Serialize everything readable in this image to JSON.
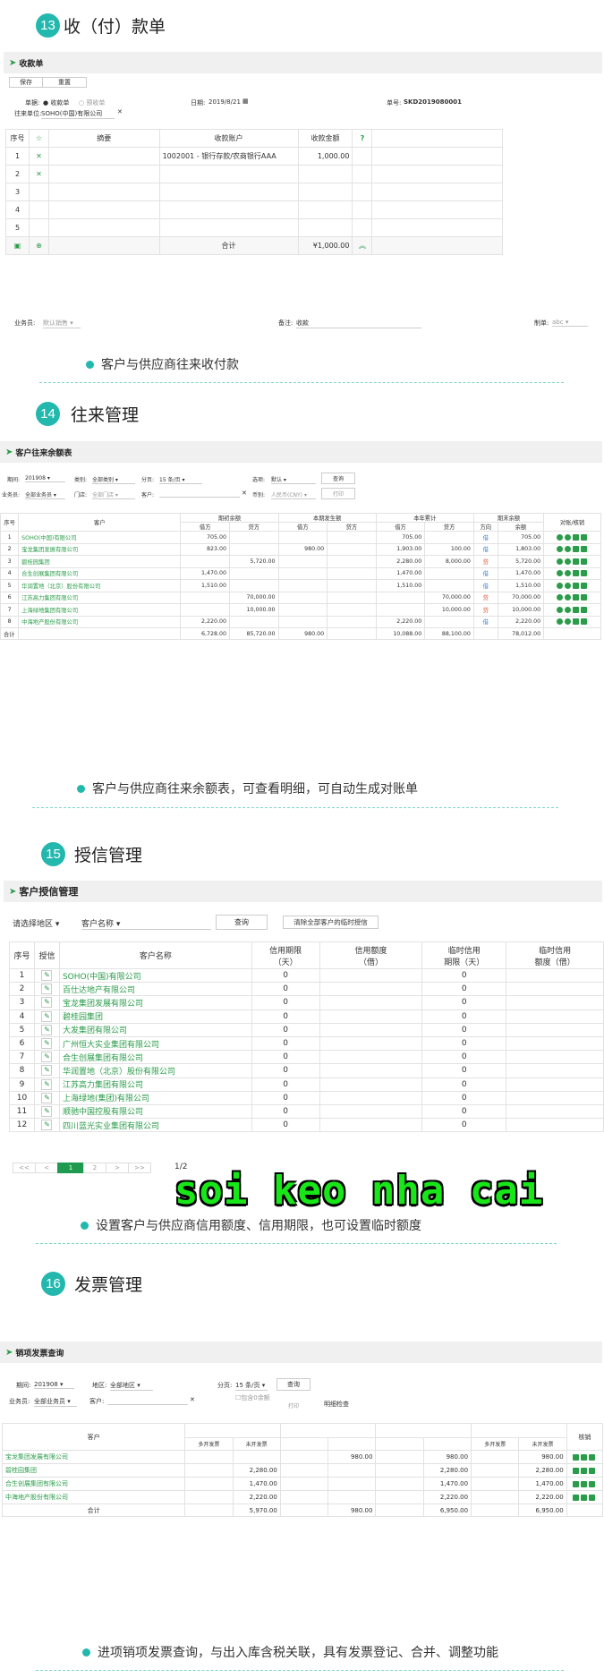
{
  "s13": {
    "num": "13",
    "title": "收（付）款单",
    "bar": "收款单",
    "btn_save": "保存",
    "btn_reset": "重置",
    "doc_type_label": "单据:",
    "opt_receipt": "收款单",
    "opt_prereceipt": "预收单",
    "date_label": "日期:",
    "date": "2019/8/21",
    "no_label": "单号:",
    "no": "SKD2019080001",
    "partner_label": "往来单位:",
    "partner": "SOHO(中国)有限公司",
    "cols": [
      "序号",
      "",
      "摘要",
      "收款账户",
      "收款金额",
      "?"
    ],
    "rows": [
      [
        "1",
        "1002001 - 银行存款/农商银行AAA",
        "1,000.00"
      ],
      [
        "2",
        "",
        ""
      ],
      [
        "3",
        "",
        ""
      ],
      [
        "4",
        "",
        ""
      ],
      [
        "5",
        "",
        ""
      ]
    ],
    "sum_label": "合计",
    "sum": "¥1,000.00",
    "foot_sales_label": "业务员:",
    "foot_sales": "默认销售",
    "foot_note_label": "备注:",
    "foot_note": "收款",
    "foot_maker_label": "制单:",
    "foot_maker": "abc",
    "bullet": "客户与供应商往来收付款"
  },
  "s14": {
    "num": "14",
    "title": "往来管理",
    "bar": "客户往来余额表",
    "f_period_l": "期间:",
    "f_period": "201908",
    "f_cat_l": "类别:",
    "f_cat": "全部类别",
    "f_page_l": "分页:",
    "f_page": "15 条/页",
    "f_opt_l": "选项:",
    "f_opt": "默认",
    "btn_query": "查询",
    "f_staff_l": "业务员:",
    "f_staff": "全部业务员",
    "f_store_l": "门店:",
    "f_store": "全部门店",
    "f_cust_l": "客户:",
    "f_cur_l": "币别:",
    "f_cur": "人民币(CNY)",
    "btn_print": "打印",
    "h1": [
      "序号",
      "客户",
      "期初余额",
      "本期发生额",
      "本年累计",
      "期末余额",
      "对账/核销"
    ],
    "h2": [
      "借方",
      "贷方",
      "借方",
      "贷方",
      "借方",
      "贷方",
      "方向",
      "余额"
    ],
    "rows": [
      [
        "1",
        "SOHO(中国)有限公司",
        "705.00",
        "",
        "",
        "",
        "705.00",
        "",
        "借",
        "705.00"
      ],
      [
        "2",
        "宝龙集团发展有限公司",
        "823.00",
        "",
        "980.00",
        "",
        "1,903.00",
        "100.00",
        "借",
        "1,803.00"
      ],
      [
        "3",
        "碧桂园集团",
        "",
        "5,720.00",
        "",
        "",
        "2,280.00",
        "8,000.00",
        "贷",
        "5,720.00"
      ],
      [
        "4",
        "合生创展集团有限公司",
        "1,470.00",
        "",
        "",
        "",
        "1,470.00",
        "",
        "借",
        "1,470.00"
      ],
      [
        "5",
        "华润置地（北京）股份有限公司",
        "1,510.00",
        "",
        "",
        "",
        "1,510.00",
        "",
        "借",
        "1,510.00"
      ],
      [
        "6",
        "江苏高力集团有限公司",
        "",
        "70,000.00",
        "",
        "",
        "",
        "70,000.00",
        "贷",
        "70,000.00"
      ],
      [
        "7",
        "上海绿地集团有限公司",
        "",
        "10,000.00",
        "",
        "",
        "",
        "10,000.00",
        "贷",
        "10,000.00"
      ],
      [
        "8",
        "中海地产股份有限公司",
        "2,220.00",
        "",
        "",
        "",
        "2,220.00",
        "",
        "借",
        "2,220.00"
      ]
    ],
    "total_label": "合计",
    "total": [
      "6,728.00",
      "85,720.00",
      "980.00",
      "",
      "10,088.00",
      "88,100.00",
      "",
      "78,012.00"
    ],
    "bullet": "客户与供应商往来余额表，可查看明细，可自动生成对账单"
  },
  "s15": {
    "num": "15",
    "title": "授信管理",
    "bar": "客户授信管理",
    "f_region": "请选择地区",
    "f_name": "客户名称",
    "btn_query": "查询",
    "btn_clear": "清除全部客户的临时授信",
    "cols": [
      "序号",
      "授信",
      "客户名称",
      "信用期限\n（天）",
      "信用额度\n（借）",
      "临时信用\n期限（天）",
      "临时信用\n额度（借）"
    ],
    "rows": [
      [
        "1",
        "SOHO(中国)有限公司",
        "0",
        "0"
      ],
      [
        "2",
        "百仕达地产有限公司",
        "0",
        "0"
      ],
      [
        "3",
        "宝龙集团发展有限公司",
        "0",
        "0"
      ],
      [
        "4",
        "碧桂园集团",
        "0",
        "0"
      ],
      [
        "5",
        "大发集团有限公司",
        "0",
        "0"
      ],
      [
        "6",
        "广州恒大实业集团有限公司",
        "0",
        "0"
      ],
      [
        "7",
        "合生创展集团有限公司",
        "0",
        "0"
      ],
      [
        "8",
        "华润置地（北京）股份有限公司",
        "0",
        "0"
      ],
      [
        "9",
        "江苏高力集团有限公司",
        "0",
        "0"
      ],
      [
        "10",
        "上海绿地(集团)有限公司",
        "0",
        "0"
      ],
      [
        "11",
        "顺驰中国控股有限公司",
        "0",
        "0"
      ],
      [
        "12",
        "四川蓝光实业集团有限公司",
        "0",
        "0"
      ]
    ],
    "pager": [
      "<<",
      "<",
      "1",
      "2",
      ">",
      ">>"
    ],
    "page_info": "1/2",
    "bullet": "设置客户与供应商信用额度、信用期限，也可设置临时额度"
  },
  "s16": {
    "num": "16",
    "title": "发票管理",
    "bar": "销项发票查询",
    "f_period_l": "期间:",
    "f_period": "201908",
    "f_region_l": "地区:",
    "f_region": "全部地区",
    "f_page_l": "分页:",
    "f_page": "15 条/页",
    "btn_query": "查询",
    "f_staff_l": "业务员:",
    "f_staff": "全部业务员",
    "f_cust_l": "客户:",
    "f_zero": "包含0余额",
    "btn_print": "打印",
    "link_detail": "明细检查",
    "h_cust": "客户",
    "h_ops": "核销",
    "sub": [
      "多开发票",
      "未开发票"
    ],
    "rows": [
      [
        "宝龙集团发展有限公司",
        "",
        "",
        "",
        "980.00",
        "",
        "980.00",
        "",
        "980.00"
      ],
      [
        "碧桂园集团",
        "",
        "2,280.00",
        "",
        "",
        "",
        "2,280.00",
        "",
        "2,280.00"
      ],
      [
        "合生创展集团有限公司",
        "",
        "1,470.00",
        "",
        "",
        "",
        "1,470.00",
        "",
        "1,470.00"
      ],
      [
        "中海地产股份有限公司",
        "",
        "2,220.00",
        "",
        "",
        "",
        "2,220.00",
        "",
        "2,220.00"
      ]
    ],
    "total_label": "合计",
    "total": [
      "",
      "5,970.00",
      "",
      "980.00",
      "",
      "6,950.00",
      "",
      "6,950.00"
    ],
    "bullet": "进项销项发票查询，与出入库含税关联，具有发票登记、合并、调整功能"
  },
  "watermark": "soi keo nha cai"
}
